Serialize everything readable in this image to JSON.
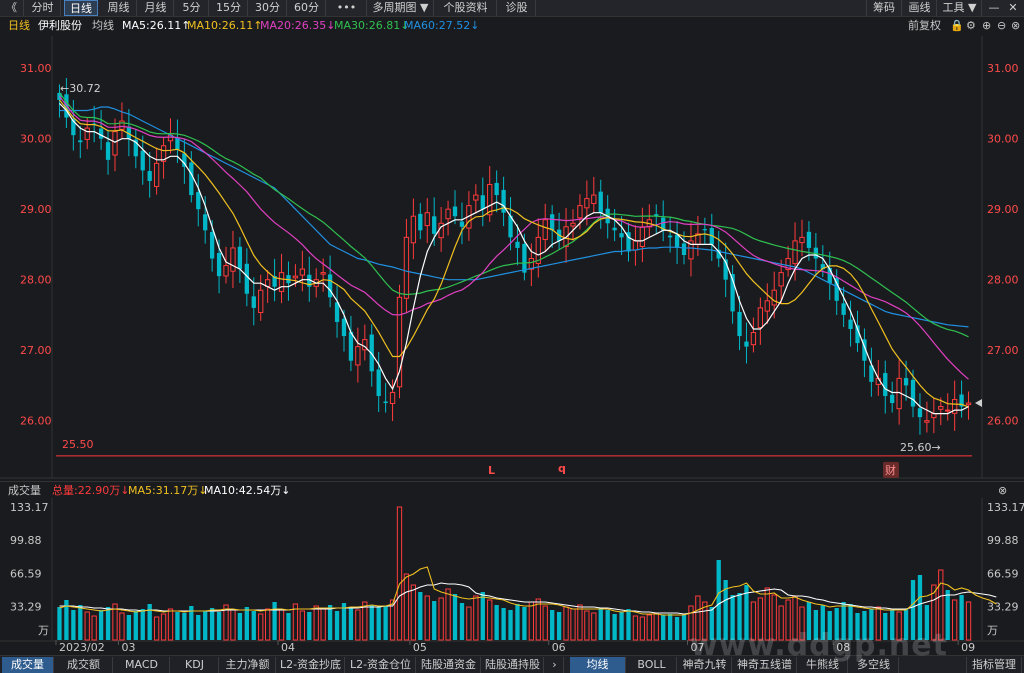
{
  "toolbar": {
    "back": "《",
    "items": [
      "分时",
      "日线",
      "周线",
      "月线",
      "5分",
      "15分",
      "30分",
      "60分",
      "•••",
      "多周期图 ▼",
      "个股资料",
      "诊股"
    ],
    "right": [
      "筹码",
      "画线",
      "工具 ▼"
    ]
  },
  "ma_bar": {
    "period": "日线",
    "stock": "伊利股份",
    "type": "均线",
    "ma5": "MA5:26.11↑",
    "ma10": "MA10:26.11↑",
    "ma20": "MA20:26.35↓",
    "ma30": "MA30:26.81↓",
    "ma60": "MA60:27.52↓",
    "adjust": "前复权"
  },
  "price_axis": {
    "labels": [
      "31.00",
      "30.00",
      "29.00",
      "28.00",
      "27.00",
      "26.00"
    ],
    "high_mark": "←30.72",
    "low_mark": "25.60→",
    "line_label": "25.50",
    "markers": [
      "L",
      "q"
    ],
    "fin_marker": "财"
  },
  "vol_bar": {
    "title": "成交量",
    "total": "总量:22.90万↓",
    "ma5": "MA5:31.17万↓",
    "ma10": "MA10:42.54万↓"
  },
  "vol_axis": {
    "labels": [
      "133.17",
      "99.88",
      "66.59",
      "33.29"
    ],
    "unit": "万"
  },
  "x_axis": {
    "labels": [
      "2023/02",
      "03",
      "04",
      "05",
      "06",
      "07",
      "08",
      "09"
    ]
  },
  "bottom_tabs": {
    "left": [
      "成交量",
      "成交额",
      "MACD",
      "KDJ",
      "主力净额",
      "L2-资金抄底",
      "L2-资金仓位",
      "陆股通资金",
      "陆股通持股"
    ],
    "arrow": "›",
    "right": [
      "均线",
      "BOLL",
      "神奇九转",
      "神奇五线谱",
      "牛熊线",
      "多空线"
    ],
    "manage": "指标管理"
  },
  "watermark": "www.ddgp.net",
  "colors": {
    "up": "#ff3b3b",
    "down": "#00b8c8",
    "ma5": "#ffffff",
    "ma10": "#f0c020",
    "ma20": "#e040c0",
    "ma30": "#30c050",
    "ma60": "#2090e0"
  },
  "chart_data": {
    "type": "candlestick",
    "title": "伊利股份 日线",
    "ylim": [
      25.3,
      31.4
    ],
    "x_ticks": [
      "2023/02",
      "03",
      "04",
      "05",
      "06",
      "07",
      "08",
      "09"
    ],
    "price_high": 30.72,
    "price_low": 25.6,
    "reference_line": 25.5,
    "closes": [
      30.55,
      30.3,
      30.05,
      29.95,
      30.15,
      30.2,
      30.0,
      29.7,
      30.1,
      30.25,
      30.0,
      29.75,
      29.55,
      29.4,
      29.65,
      29.9,
      30.05,
      29.85,
      29.6,
      29.2,
      29.0,
      28.7,
      28.3,
      28.05,
      28.2,
      28.45,
      28.15,
      27.8,
      27.6,
      27.85,
      28.0,
      27.9,
      28.1,
      27.95,
      28.05,
      28.15,
      27.9,
      28.0,
      28.1,
      27.75,
      27.4,
      27.2,
      26.85,
      27.05,
      27.15,
      26.7,
      26.35,
      26.25,
      26.4,
      27.75,
      28.6,
      28.9,
      28.7,
      28.95,
      28.65,
      28.8,
      29.0,
      28.9,
      28.75,
      29.05,
      29.2,
      29.0,
      29.35,
      29.2,
      28.95,
      28.6,
      28.45,
      28.1,
      28.3,
      28.6,
      28.85,
      28.7,
      28.55,
      28.75,
      28.8,
      29.05,
      29.15,
      29.2,
      28.95,
      28.8,
      28.7,
      28.6,
      28.4,
      28.55,
      28.75,
      28.85,
      28.9,
      28.7,
      28.6,
      28.45,
      28.35,
      28.55,
      28.65,
      28.7,
      28.5,
      28.3,
      28.0,
      27.55,
      27.2,
      27.05,
      27.25,
      27.6,
      27.7,
      27.85,
      28.1,
      28.3,
      28.55,
      28.6,
      28.45,
      28.3,
      28.15,
      27.95,
      27.7,
      27.5,
      27.3,
      27.1,
      26.85,
      26.55,
      26.6,
      26.35,
      26.25,
      26.6,
      26.5,
      26.2,
      26.05,
      26.0,
      26.1,
      26.2,
      26.15,
      26.3,
      26.2,
      26.25
    ],
    "ma5": [
      30.5,
      30.4,
      30.25,
      30.15,
      30.1,
      30.1,
      30.05,
      30.0,
      29.95,
      30.0,
      30.0,
      29.95,
      29.85,
      29.75,
      29.7,
      29.7,
      29.75,
      29.75,
      29.65,
      29.5,
      29.3,
      29.05,
      28.75,
      28.45,
      28.25,
      28.2,
      28.15,
      28.05,
      27.95,
      27.95,
      27.9,
      27.85,
      27.9,
      27.9,
      27.95,
      28.0,
      28.0,
      27.95,
      27.95,
      27.85,
      27.7,
      27.5,
      27.25,
      27.1,
      27.05,
      26.95,
      26.8,
      26.6,
      26.45,
      26.7,
      27.1,
      27.6,
      28.05,
      28.4,
      28.6,
      28.75,
      28.8,
      28.85,
      28.85,
      28.9,
      28.95,
      29.0,
      29.05,
      29.1,
      29.05,
      28.9,
      28.75,
      28.55,
      28.4,
      28.35,
      28.4,
      28.5,
      28.55,
      28.6,
      28.7,
      28.8,
      28.9,
      28.95,
      28.95,
      28.9,
      28.85,
      28.75,
      28.6,
      28.55,
      28.55,
      28.6,
      28.65,
      28.7,
      28.7,
      28.65,
      28.55,
      28.5,
      28.5,
      28.5,
      28.5,
      28.4,
      28.25,
      28.0,
      27.7,
      27.45,
      27.3,
      27.3,
      27.4,
      27.55,
      27.7,
      27.95,
      28.15,
      28.3,
      28.35,
      28.35,
      28.3,
      28.15,
      27.95,
      27.75,
      27.55,
      27.3,
      27.05,
      26.8,
      26.6,
      26.45,
      26.4,
      26.4,
      26.35,
      26.3,
      26.2,
      26.15,
      26.1,
      26.1,
      26.1,
      26.15,
      26.15,
      26.2
    ],
    "ma60": [
      30.4,
      30.4,
      30.4,
      30.4,
      30.4,
      30.42,
      30.45,
      30.45,
      30.42,
      30.38,
      30.35,
      30.3,
      30.25,
      30.2,
      30.15,
      30.1,
      30.05,
      30.0,
      29.95,
      29.9,
      29.85,
      29.8,
      29.75,
      29.7,
      29.65,
      29.6,
      29.55,
      29.5,
      29.45,
      29.4,
      29.35,
      29.3,
      29.2,
      29.1,
      29.0,
      28.9,
      28.8,
      28.7,
      28.6,
      28.5,
      28.45,
      28.4,
      28.35,
      28.3,
      28.28,
      28.25,
      28.22,
      28.2,
      28.18,
      28.15,
      28.12,
      28.1,
      28.08,
      28.06,
      28.04,
      28.02,
      28.0,
      28.0,
      28.0,
      28.0,
      28.0,
      28.02,
      28.04,
      28.06,
      28.08,
      28.1,
      28.12,
      28.14,
      28.16,
      28.18,
      28.2,
      28.22,
      28.24,
      28.26,
      28.28,
      28.3,
      28.32,
      28.34,
      28.36,
      28.38,
      28.4,
      28.4,
      28.42,
      28.42,
      28.44,
      28.45,
      28.45,
      28.46,
      28.46,
      28.46,
      28.45,
      28.45,
      28.44,
      28.43,
      28.42,
      28.4,
      28.38,
      28.36,
      28.34,
      28.32,
      28.3,
      28.28,
      28.26,
      28.24,
      28.22,
      28.2,
      28.18,
      28.15,
      28.1,
      28.05,
      28.0,
      27.95,
      27.9,
      27.85,
      27.8,
      27.75,
      27.7,
      27.65,
      27.6,
      27.55,
      27.52,
      27.5,
      27.48,
      27.46,
      27.44,
      27.42,
      27.4,
      27.38,
      27.36,
      27.35,
      27.34,
      27.33
    ],
    "volume_ylim": [
      0,
      140
    ],
    "volumes": [
      33,
      40,
      30,
      35,
      28,
      24,
      30,
      33,
      36,
      27,
      25,
      29,
      31,
      36,
      23,
      26,
      31,
      28,
      27,
      34,
      25,
      29,
      32,
      28,
      35,
      30,
      27,
      33,
      29,
      26,
      31,
      38,
      30,
      27,
      36,
      29,
      28,
      34,
      31,
      35,
      29,
      37,
      32,
      30,
      38,
      35,
      33,
      34,
      40,
      133,
      66,
      55,
      48,
      44,
      39,
      42,
      51,
      46,
      37,
      33,
      44,
      48,
      40,
      35,
      32,
      30,
      36,
      33,
      38,
      41,
      34,
      30,
      28,
      33,
      31,
      35,
      29,
      27,
      32,
      30,
      26,
      28,
      31,
      24,
      23,
      25,
      27,
      25,
      26,
      23,
      25,
      34,
      44,
      38,
      33,
      80,
      60,
      45,
      47,
      55,
      38,
      42,
      52,
      45,
      34,
      40,
      44,
      33,
      38,
      30,
      35,
      29,
      32,
      38,
      36,
      27,
      29,
      31,
      33,
      27,
      30,
      28,
      31,
      60,
      65,
      35,
      55,
      70,
      50,
      40,
      45,
      38,
      42,
      33,
      42,
      23
    ],
    "volume_ma5": [
      32,
      34,
      33,
      32,
      31,
      30,
      29,
      30,
      31,
      30,
      29,
      28,
      29,
      30,
      29,
      28,
      29,
      29,
      28,
      29,
      29,
      29,
      30,
      30,
      31,
      31,
      30,
      30,
      30,
      29,
      30,
      31,
      31,
      30,
      31,
      31,
      31,
      32,
      32,
      32,
      32,
      32,
      33,
      33,
      34,
      35,
      34,
      34,
      36,
      56,
      63,
      66,
      71,
      73,
      51,
      48,
      46,
      44,
      42,
      41,
      42,
      43,
      42,
      41,
      40,
      37,
      35,
      34,
      34,
      36,
      36,
      36,
      35,
      33,
      31,
      31,
      31,
      31,
      31,
      31,
      29,
      28,
      29,
      28,
      26,
      26,
      26,
      25,
      25,
      25,
      25,
      27,
      30,
      33,
      35,
      47,
      51,
      53,
      54,
      57,
      49,
      46,
      46,
      47,
      42,
      42,
      43,
      40,
      38,
      36,
      35,
      33,
      34,
      34,
      34,
      33,
      32,
      31,
      31,
      30,
      30,
      30,
      30,
      36,
      43,
      44,
      47,
      57,
      55,
      50,
      52,
      50,
      45,
      42,
      40,
      36
    ],
    "volume_ma10": [
      34,
      34,
      34,
      33,
      33,
      32,
      32,
      31,
      31,
      31,
      30,
      30,
      29,
      30,
      30,
      29,
      29,
      29,
      29,
      29,
      29,
      29,
      29,
      29,
      30,
      30,
      30,
      30,
      30,
      30,
      30,
      30,
      30,
      30,
      31,
      31,
      31,
      31,
      31,
      31,
      32,
      32,
      32,
      32,
      33,
      33,
      33,
      34,
      34,
      44,
      48,
      50,
      53,
      55,
      55,
      57,
      56,
      56,
      55,
      53,
      47,
      45,
      44,
      42,
      41,
      40,
      39,
      38,
      38,
      38,
      38,
      37,
      36,
      35,
      34,
      33,
      33,
      33,
      32,
      32,
      31,
      30,
      29,
      29,
      28,
      28,
      27,
      27,
      27,
      27,
      26,
      27,
      28,
      29,
      30,
      36,
      40,
      43,
      45,
      47,
      48,
      49,
      50,
      51,
      50,
      45,
      44,
      44,
      43,
      41,
      40,
      38,
      37,
      36,
      35,
      34,
      33,
      33,
      32,
      32,
      31,
      31,
      31,
      33,
      36,
      38,
      40,
      44,
      45,
      45,
      47,
      48,
      47,
      46,
      45,
      43
    ]
  }
}
